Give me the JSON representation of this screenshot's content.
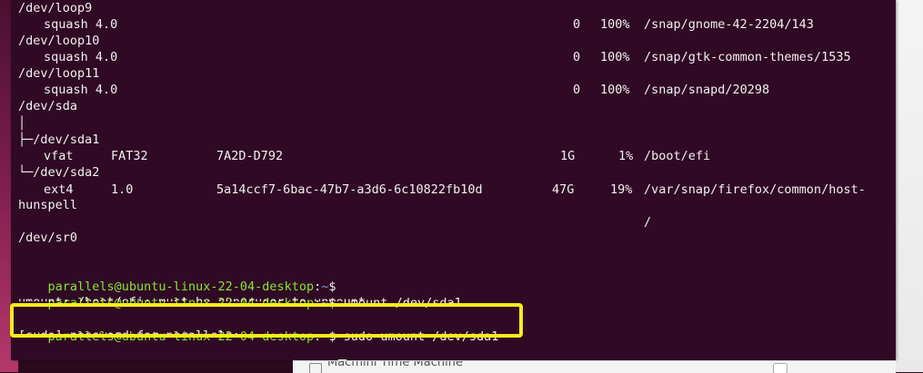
{
  "terminal": {
    "devices": [
      {
        "path": "/dev/loop9",
        "fstype": "squash 4.0",
        "avail": "0",
        "use": "100%",
        "mount": "/snap/gnome-42-2204/143"
      },
      {
        "path": "/dev/loop10",
        "fstype": "squash 4.0",
        "avail": "0",
        "use": "100%",
        "mount": "/snap/gtk-common-themes/1535"
      },
      {
        "path": "/dev/loop11",
        "fstype": "squash 4.0",
        "avail": "0",
        "use": "100%",
        "mount": "/snap/snapd/20298"
      }
    ],
    "sda": {
      "path": "/dev/sda",
      "tree_top": "│",
      "sda1": {
        "path": "├─/dev/sda1",
        "fstype": "vfat",
        "fsver": "FAT32",
        "uuid": "7A2D-D792",
        "avail": "1G",
        "use": "1%",
        "mount": "/boot/efi"
      },
      "sda2": {
        "path": "└─/dev/sda2",
        "fstype": "ext4",
        "fsver": "1.0",
        "uuid": "5a14ccf7-6bac-47b7-a3d6-6c10822fb10d",
        "avail": "47G",
        "use": "19%",
        "mount": "/var/snap/firefox/common/host-",
        "mount_wrap": "hunspell",
        "mount_cont": "/"
      }
    },
    "sr0": "/dev/sr0",
    "prompt": {
      "user_host": "parallels@ubuntu-linux-22-04-desktop",
      "sep": ":",
      "path": "~",
      "symbol": "$"
    },
    "commands": [
      {
        "cmd": "",
        "output": ""
      },
      {
        "cmd": " umount /dev/sda1",
        "output": "umount: /boot/efi: must be superuser to unmount."
      },
      {
        "cmd": " sudo umount /dev/sda1",
        "output": "[sudo] password for parallels:"
      },
      {
        "cmd": "",
        "output": ""
      }
    ]
  },
  "taskbar": {
    "label": "Macmini Time Machine"
  },
  "colors": {
    "terminal_bg": "#300a24",
    "prompt_user": "#8ae234",
    "prompt_path": "#729fcf",
    "highlight": "#f5ec1b"
  }
}
